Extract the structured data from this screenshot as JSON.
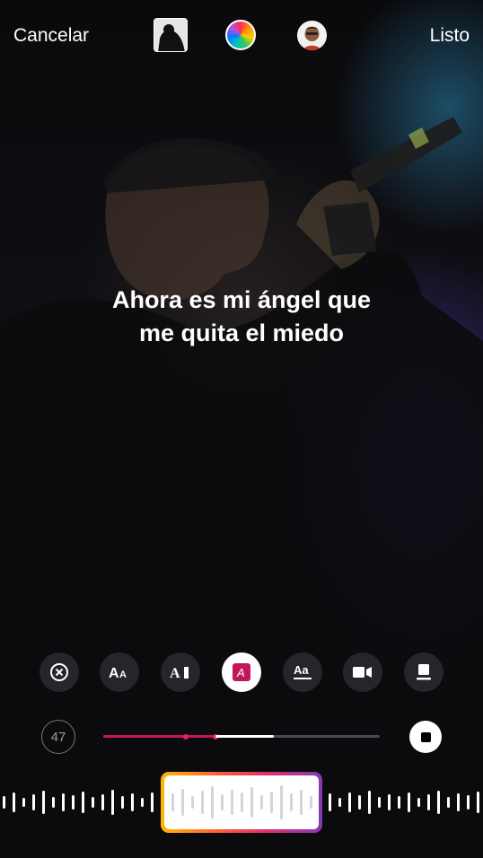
{
  "topbar": {
    "cancel_label": "Cancelar",
    "done_label": "Listo"
  },
  "lyrics": {
    "line1": "Ahora es mi ángel que",
    "line2": "me quita el miedo"
  },
  "tools": [
    {
      "name": "remove-style-icon",
      "glyph": "×",
      "selected": false
    },
    {
      "name": "typewriter-style-icon",
      "glyph": "AA",
      "selected": false
    },
    {
      "name": "cursor-style-icon",
      "glyph": "A",
      "selected": false
    },
    {
      "name": "highlight-style-icon",
      "glyph": "A",
      "selected": true
    },
    {
      "name": "underline-style-icon",
      "glyph": "Aa",
      "selected": false
    },
    {
      "name": "video-icon",
      "glyph": "",
      "selected": false
    },
    {
      "name": "card-icon",
      "glyph": "",
      "selected": false
    }
  ],
  "player": {
    "duration_seconds": "47",
    "progress_played_fraction": 0.41,
    "selection_end_fraction": 0.62
  },
  "colors": {
    "accent_pink": "#e91e63",
    "gradient": [
      "#ffb800",
      "#ff5e3a",
      "#e1306c",
      "#833ab4"
    ]
  }
}
